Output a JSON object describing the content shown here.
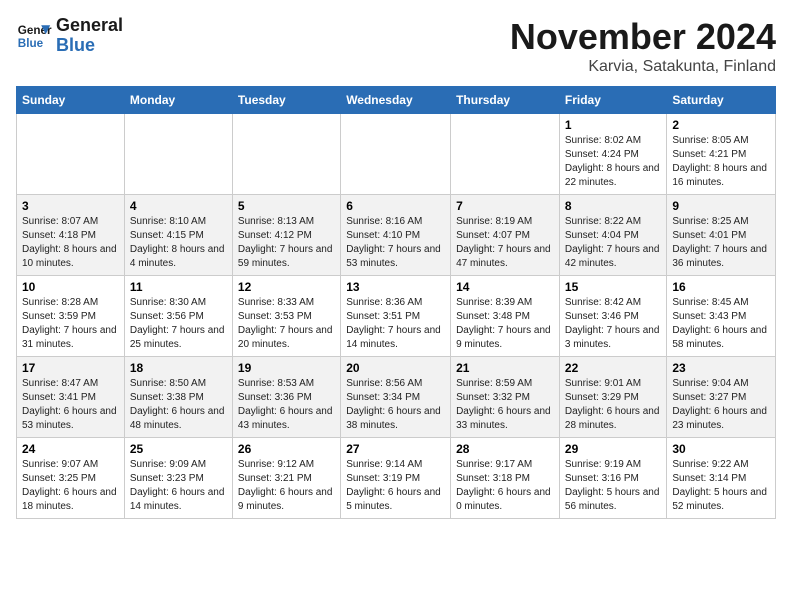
{
  "header": {
    "logo_general": "General",
    "logo_blue": "Blue",
    "month": "November 2024",
    "location": "Karvia, Satakunta, Finland"
  },
  "weekdays": [
    "Sunday",
    "Monday",
    "Tuesday",
    "Wednesday",
    "Thursday",
    "Friday",
    "Saturday"
  ],
  "weeks": [
    [
      {
        "day": "",
        "info": ""
      },
      {
        "day": "",
        "info": ""
      },
      {
        "day": "",
        "info": ""
      },
      {
        "day": "",
        "info": ""
      },
      {
        "day": "",
        "info": ""
      },
      {
        "day": "1",
        "info": "Sunrise: 8:02 AM\nSunset: 4:24 PM\nDaylight: 8 hours and 22 minutes."
      },
      {
        "day": "2",
        "info": "Sunrise: 8:05 AM\nSunset: 4:21 PM\nDaylight: 8 hours and 16 minutes."
      }
    ],
    [
      {
        "day": "3",
        "info": "Sunrise: 8:07 AM\nSunset: 4:18 PM\nDaylight: 8 hours and 10 minutes."
      },
      {
        "day": "4",
        "info": "Sunrise: 8:10 AM\nSunset: 4:15 PM\nDaylight: 8 hours and 4 minutes."
      },
      {
        "day": "5",
        "info": "Sunrise: 8:13 AM\nSunset: 4:12 PM\nDaylight: 7 hours and 59 minutes."
      },
      {
        "day": "6",
        "info": "Sunrise: 8:16 AM\nSunset: 4:10 PM\nDaylight: 7 hours and 53 minutes."
      },
      {
        "day": "7",
        "info": "Sunrise: 8:19 AM\nSunset: 4:07 PM\nDaylight: 7 hours and 47 minutes."
      },
      {
        "day": "8",
        "info": "Sunrise: 8:22 AM\nSunset: 4:04 PM\nDaylight: 7 hours and 42 minutes."
      },
      {
        "day": "9",
        "info": "Sunrise: 8:25 AM\nSunset: 4:01 PM\nDaylight: 7 hours and 36 minutes."
      }
    ],
    [
      {
        "day": "10",
        "info": "Sunrise: 8:28 AM\nSunset: 3:59 PM\nDaylight: 7 hours and 31 minutes."
      },
      {
        "day": "11",
        "info": "Sunrise: 8:30 AM\nSunset: 3:56 PM\nDaylight: 7 hours and 25 minutes."
      },
      {
        "day": "12",
        "info": "Sunrise: 8:33 AM\nSunset: 3:53 PM\nDaylight: 7 hours and 20 minutes."
      },
      {
        "day": "13",
        "info": "Sunrise: 8:36 AM\nSunset: 3:51 PM\nDaylight: 7 hours and 14 minutes."
      },
      {
        "day": "14",
        "info": "Sunrise: 8:39 AM\nSunset: 3:48 PM\nDaylight: 7 hours and 9 minutes."
      },
      {
        "day": "15",
        "info": "Sunrise: 8:42 AM\nSunset: 3:46 PM\nDaylight: 7 hours and 3 minutes."
      },
      {
        "day": "16",
        "info": "Sunrise: 8:45 AM\nSunset: 3:43 PM\nDaylight: 6 hours and 58 minutes."
      }
    ],
    [
      {
        "day": "17",
        "info": "Sunrise: 8:47 AM\nSunset: 3:41 PM\nDaylight: 6 hours and 53 minutes."
      },
      {
        "day": "18",
        "info": "Sunrise: 8:50 AM\nSunset: 3:38 PM\nDaylight: 6 hours and 48 minutes."
      },
      {
        "day": "19",
        "info": "Sunrise: 8:53 AM\nSunset: 3:36 PM\nDaylight: 6 hours and 43 minutes."
      },
      {
        "day": "20",
        "info": "Sunrise: 8:56 AM\nSunset: 3:34 PM\nDaylight: 6 hours and 38 minutes."
      },
      {
        "day": "21",
        "info": "Sunrise: 8:59 AM\nSunset: 3:32 PM\nDaylight: 6 hours and 33 minutes."
      },
      {
        "day": "22",
        "info": "Sunrise: 9:01 AM\nSunset: 3:29 PM\nDaylight: 6 hours and 28 minutes."
      },
      {
        "day": "23",
        "info": "Sunrise: 9:04 AM\nSunset: 3:27 PM\nDaylight: 6 hours and 23 minutes."
      }
    ],
    [
      {
        "day": "24",
        "info": "Sunrise: 9:07 AM\nSunset: 3:25 PM\nDaylight: 6 hours and 18 minutes."
      },
      {
        "day": "25",
        "info": "Sunrise: 9:09 AM\nSunset: 3:23 PM\nDaylight: 6 hours and 14 minutes."
      },
      {
        "day": "26",
        "info": "Sunrise: 9:12 AM\nSunset: 3:21 PM\nDaylight: 6 hours and 9 minutes."
      },
      {
        "day": "27",
        "info": "Sunrise: 9:14 AM\nSunset: 3:19 PM\nDaylight: 6 hours and 5 minutes."
      },
      {
        "day": "28",
        "info": "Sunrise: 9:17 AM\nSunset: 3:18 PM\nDaylight: 6 hours and 0 minutes."
      },
      {
        "day": "29",
        "info": "Sunrise: 9:19 AM\nSunset: 3:16 PM\nDaylight: 5 hours and 56 minutes."
      },
      {
        "day": "30",
        "info": "Sunrise: 9:22 AM\nSunset: 3:14 PM\nDaylight: 5 hours and 52 minutes."
      }
    ]
  ]
}
